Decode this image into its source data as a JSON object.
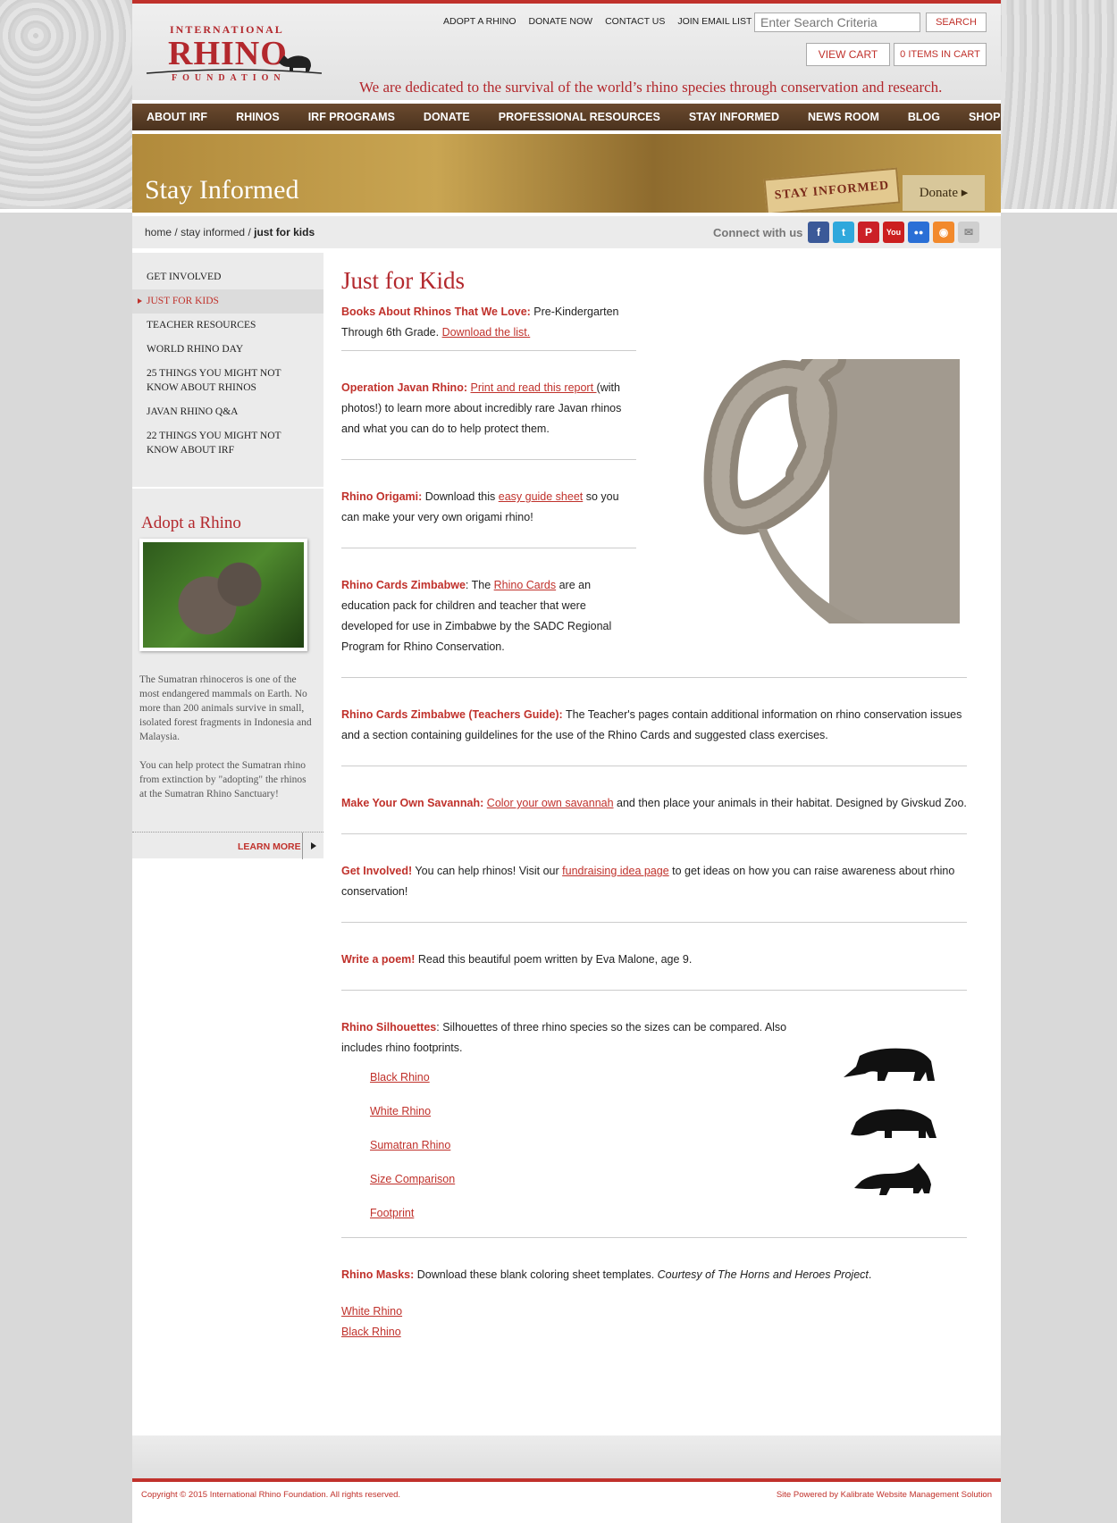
{
  "header": {
    "logo": {
      "line1": "INTERNATIONAL",
      "line2": "RHINO",
      "line3": "FOUNDATION"
    },
    "top_links": [
      "ADOPT A RHINO",
      "DONATE NOW",
      "CONTACT US",
      "JOIN EMAIL LIST"
    ],
    "search": {
      "placeholder": "Enter Search Criteria",
      "button": "SEARCH"
    },
    "cart": {
      "view": "VIEW CART",
      "items": "0 ITEMS IN CART"
    },
    "tagline": "We are dedicated to the survival of the world’s rhino species through conservation and research."
  },
  "nav": [
    "ABOUT IRF",
    "RHINOS",
    "IRF PROGRAMS",
    "DONATE",
    "PROFESSIONAL RESOURCES",
    "STAY INFORMED",
    "NEWS ROOM",
    "BLOG",
    "SHOP"
  ],
  "hero": {
    "title": "Stay Informed",
    "badge": "STAY INFORMED",
    "donate": "Donate ▸"
  },
  "breadcrumb": {
    "home": "home",
    "sep": "/",
    "section": "stay informed",
    "current": "just for kids"
  },
  "connect": {
    "label": "Connect with us",
    "icons": [
      {
        "name": "facebook-icon",
        "glyph": "f",
        "color": "#3b5998"
      },
      {
        "name": "twitter-icon",
        "glyph": "t",
        "color": "#2fa8dc"
      },
      {
        "name": "pinterest-icon",
        "glyph": "P",
        "color": "#cb2027"
      },
      {
        "name": "youtube-icon",
        "glyph": "You",
        "color": "#cc1f1f"
      },
      {
        "name": "flickr-icon",
        "glyph": "●●",
        "color": "#2a6fd6"
      },
      {
        "name": "rss-icon",
        "glyph": "◉",
        "color": "#f2892c"
      },
      {
        "name": "email-icon",
        "glyph": "✉",
        "color": "#cfcfcf"
      }
    ]
  },
  "sidebar": {
    "items": [
      "GET INVOLVED",
      "JUST FOR KIDS",
      "TEACHER RESOURCES",
      "WORLD RHINO DAY",
      "25 THINGS YOU MIGHT NOT KNOW ABOUT RHINOS",
      "JAVAN RHINO Q&A",
      "22 THINGS YOU MIGHT NOT KNOW ABOUT IRF"
    ],
    "adopt": {
      "title": "Adopt a Rhino",
      "p1": "The Sumatran rhinoceros is one of the most endangered mammals on Earth. No more than 200 animals survive in small, isolated forest fragments in Indonesia and Malaysia.",
      "p2": "You can help protect the Sumatran rhino from extinction by \"adopting\" the rhinos at the Sumatran Rhino Sanctuary!",
      "learn_more": "LEARN MORE"
    }
  },
  "main": {
    "title": "Just for Kids",
    "books": {
      "label": "Books About Rhinos That We Love:",
      "text": " Pre-Kindergarten Through 6th Grade. ",
      "link": "Download the list."
    },
    "javan": {
      "label": "Operation Javan Rhino:",
      "link": "Print and read this report ",
      "text": "(with photos!) to learn more about incredibly rare Javan rhinos and what you can do to help protect them."
    },
    "origami": {
      "label": "Rhino Origami:",
      "text1": " Download this ",
      "link": "easy guide sheet",
      "text2": " so you can make your very own origami rhino!"
    },
    "cards": {
      "label": "Rhino Cards Zimbabwe",
      "text1": ": The ",
      "link": "Rhino Cards",
      "text2": " are an education pack for children and teacher that were developed for use in Zimbabwe by the SADC Regional Program for Rhino Conservation."
    },
    "teachers": {
      "label": "Rhino Cards Zimbabwe (Teachers Guide):",
      "text": " The Teacher's pages contain additional information on rhino conservation issues and a section containing guildelines for the use of the Rhino Cards and suggested class exercises."
    },
    "savannah": {
      "label": "Make Your Own Savannah:",
      "link": "Color your own savannah",
      "text": " and then place your animals in their habitat. Designed by Givskud Zoo."
    },
    "involved": {
      "label": "Get Involved!",
      "text1": " You can help rhinos! Visit our ",
      "link": "fundraising idea page",
      "text2": " to get ideas on how you can raise awareness about rhino conservation!"
    },
    "poem": {
      "label": "Write a poem!",
      "text": " Read this beautiful poem written by Eva Malone, age 9."
    },
    "silhouettes": {
      "label": "Rhino Silhouettes",
      "text": ": Silhouettes of three rhino species so the sizes can be compared. Also includes rhino footprints.",
      "links": [
        "Black Rhino",
        "White Rhino",
        "Sumatran Rhino",
        "Size Comparison",
        "Footprint"
      ]
    },
    "masks": {
      "label": "Rhino Masks:",
      "text": " Download these blank coloring sheet templates. ",
      "credit": "Courtesy of The Horns and Heroes Project",
      "end": ".",
      "links": [
        "White Rhino",
        "Black Rhino"
      ]
    }
  },
  "footer": {
    "copyright": "Copyright © 2015 International Rhino Foundation. All rights reserved.",
    "powered": "Site Powered by Kalibrate Website Management Solution"
  }
}
